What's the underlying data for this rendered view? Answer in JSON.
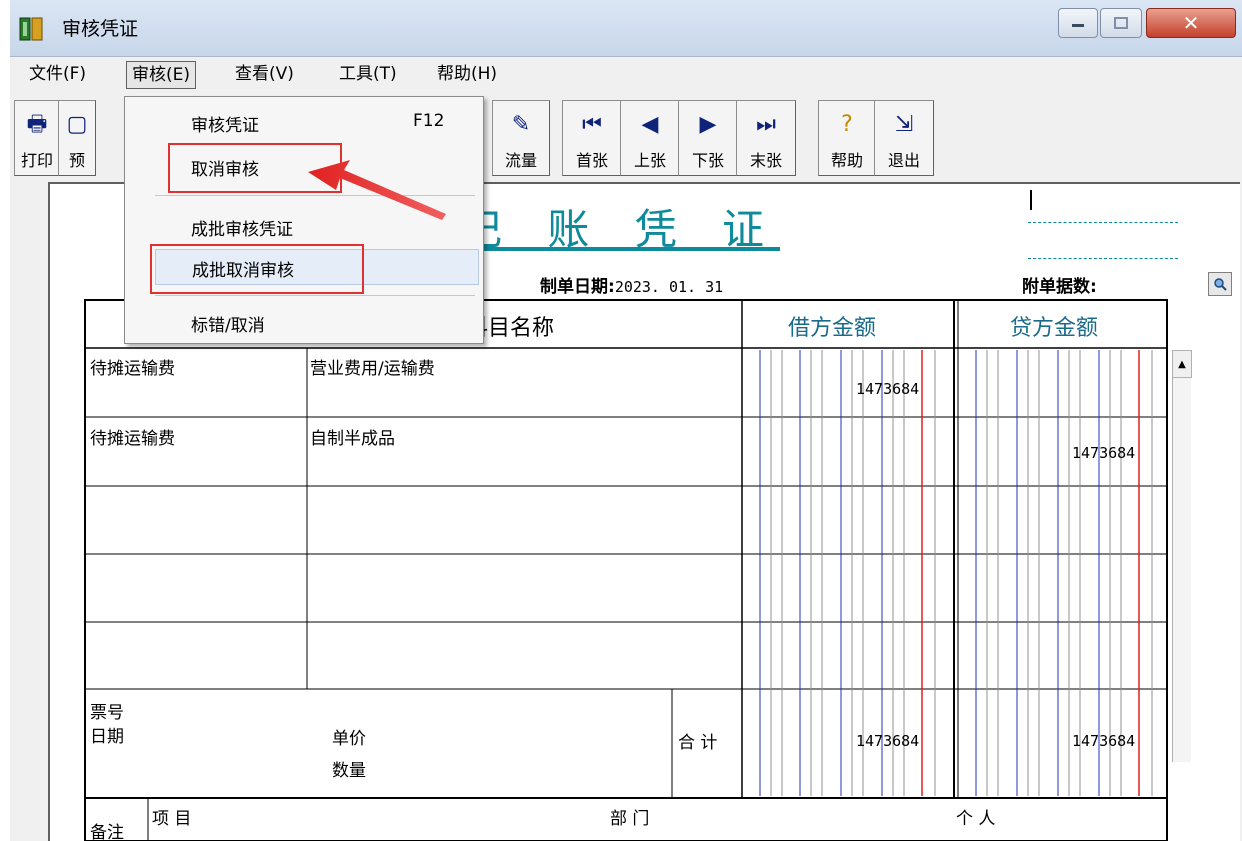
{
  "window": {
    "title": "审核凭证"
  },
  "menubar": {
    "file": "文件(F)",
    "audit": "审核(E)",
    "view": "查看(V)",
    "tools": "工具(T)",
    "help": "帮助(H)"
  },
  "toolbar": {
    "print": "打印",
    "preview": "预",
    "cashflow": "流量",
    "first": "首张",
    "prev": "上张",
    "next": "下张",
    "last": "末张",
    "help": "帮助",
    "exit": "退出"
  },
  "dropdown": {
    "audit_voucher": "审核凭证",
    "audit_shortcut": "F12",
    "cancel_audit": "取消审核",
    "batch_audit": "成批审核凭证",
    "batch_cancel": "成批取消审核",
    "mark_error": "标错/取消"
  },
  "voucher": {
    "title": "记 账 凭 证",
    "date_label": "制单日期:",
    "date_value": "2023. 01. 31",
    "attach_label": "附单据数:",
    "col_subject": "科目名称",
    "col_debit": "借方金额",
    "col_credit": "贷方金额",
    "rows": [
      {
        "summary": "待摊运输费",
        "subject": "营业费用/运输费",
        "debit": "1473684",
        "credit": ""
      },
      {
        "summary": "待摊运输费",
        "subject": "自制半成品",
        "debit": "",
        "credit": "1473684"
      }
    ],
    "footer": {
      "ticket": "票号",
      "date": "日期",
      "unit_price": "单价",
      "quantity": "数量",
      "total_label": "合 计",
      "total_debit": "1473684",
      "total_credit": "1473684"
    },
    "remarks": {
      "label": "备注",
      "item": "项 目",
      "department": "部 门",
      "person": "个 人"
    }
  }
}
